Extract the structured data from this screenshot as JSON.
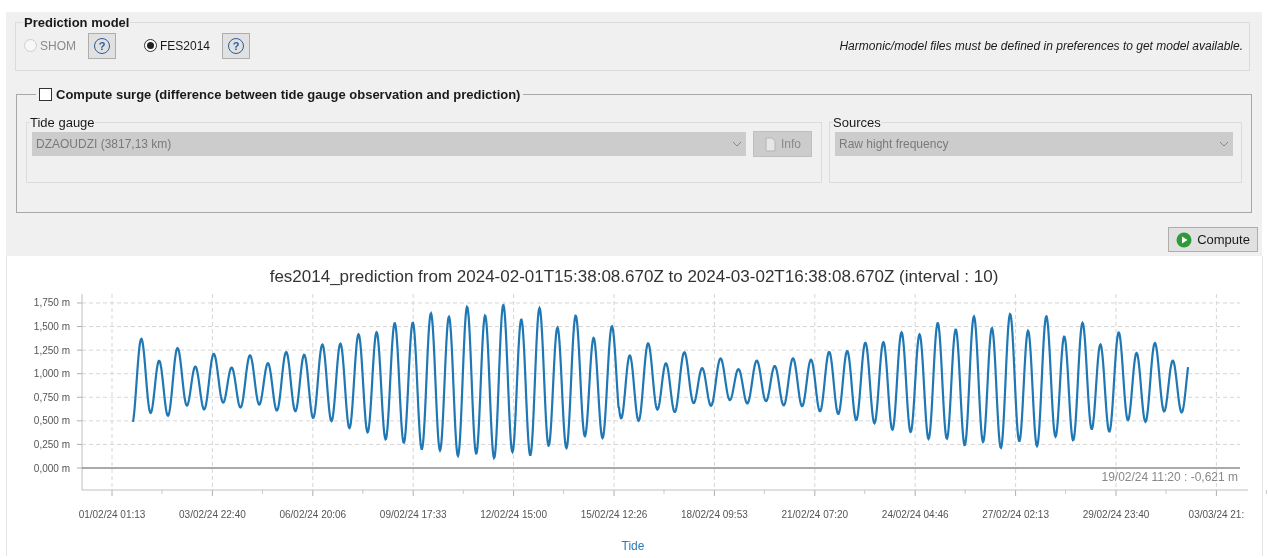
{
  "prediction_model": {
    "title": "Prediction model",
    "options": [
      {
        "label": "SHOM",
        "selected": false,
        "disabled": true,
        "help": "?"
      },
      {
        "label": "FES2014",
        "selected": true,
        "disabled": false,
        "help": "?"
      }
    ],
    "note": "Harmonic/model files must be defined in preferences to get model available."
  },
  "surge": {
    "label": "Compute surge (difference between tide gauge observation and prediction)",
    "checked": false,
    "tide_gauge": {
      "title": "Tide gauge",
      "value": "DZAOUDZI (3817,13 km)",
      "disabled": true
    },
    "info_button": {
      "label": "Info",
      "disabled": true
    },
    "sources": {
      "title": "Sources",
      "value": "Raw hight frequency",
      "disabled": true
    }
  },
  "compute_button": {
    "label": "Compute"
  },
  "chart": {
    "title": "fes2014_prediction from 2024-02-01T15:38:08.670Z to 2024-03-02T16:38:08.670Z (interval : 10)",
    "yticks": [
      "1,750 m",
      "1,500 m",
      "1,250 m",
      "1,000 m",
      "0,750 m",
      "0,500 m",
      "0,250 m",
      "0,000 m"
    ],
    "xticks": [
      "01/02/24 01:13",
      "03/02/24 22:40",
      "06/02/24 20:06",
      "09/02/24 17:33",
      "12/02/24 15:00",
      "15/02/24 12:26",
      "18/02/24 09:53",
      "21/02/24 07:20",
      "24/02/24 04:46",
      "27/02/24 02:13",
      "29/02/24 23:40",
      "03/03/24 21:"
    ],
    "xlabel": "Tide",
    "readout": "19/02/24 11:20 : -0,621 m"
  }
}
